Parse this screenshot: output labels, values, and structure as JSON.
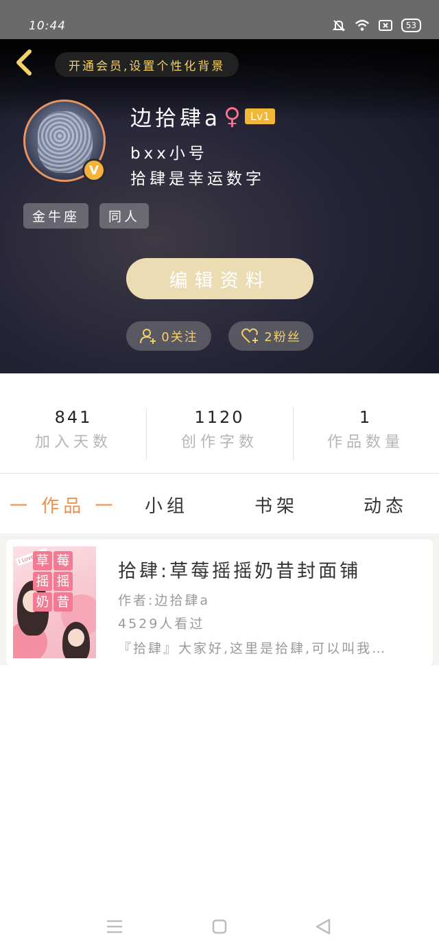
{
  "status_bar": {
    "time": "10:44",
    "battery": "53",
    "icons": [
      "bell-off-icon",
      "wifi-icon",
      "sim-icon",
      "battery-icon"
    ]
  },
  "header": {
    "vip_banner": "开通会员,设置个性化背景",
    "username": "边拾肆a",
    "gender_symbol": "♀",
    "level": "Lv1",
    "bio_line1": "bxx小号",
    "bio_line2": "拾肆是幸运数字",
    "tags": [
      "金牛座",
      "同人"
    ],
    "edit_button": "编辑资料",
    "following": "0关注",
    "fans": "2粉丝"
  },
  "stats": [
    {
      "value": "841",
      "label": "加入天数"
    },
    {
      "value": "1120",
      "label": "创作字数"
    },
    {
      "value": "1",
      "label": "作品数量"
    }
  ],
  "tabs": [
    {
      "label": "一 作品 一",
      "active": true
    },
    {
      "label": "小组",
      "active": false
    },
    {
      "label": "书架",
      "active": false
    },
    {
      "label": "动态",
      "active": false
    }
  ],
  "works": [
    {
      "title": "拾肆:草莓摇摇奶昔封面铺",
      "author": "作者:边拾肆a",
      "views": "4529人看过",
      "excerpt": "『拾肆』大家好,这里是拾肆,可以叫我…",
      "cover_chars": [
        "草",
        "莓",
        "摇",
        "摇",
        "奶",
        "昔"
      ],
      "cover_ribbon": "I Love you"
    }
  ],
  "colors": {
    "accent": "#f08f4c",
    "gold": "#f2d06a",
    "edit_button": "#ebdcb4",
    "level_badge": "#f2b736"
  }
}
